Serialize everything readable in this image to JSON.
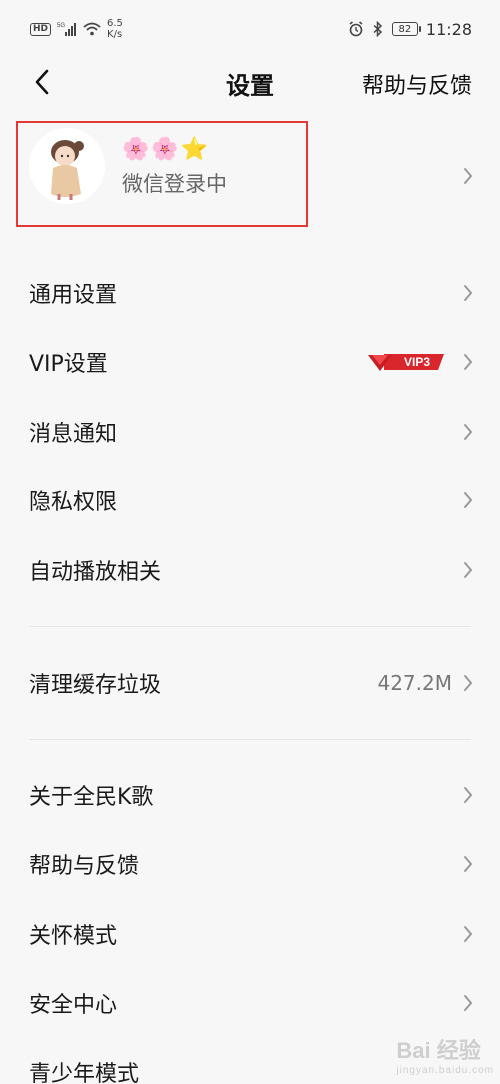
{
  "status_bar": {
    "network_badge": "HD",
    "signal_label": "5G",
    "speed_value": "6.5",
    "speed_unit": "K/s",
    "battery": "82",
    "time": "11:28"
  },
  "nav": {
    "title": "设置",
    "help_label": "帮助与反馈"
  },
  "profile": {
    "nickname_flowers": "🌸🌸",
    "nickname_star": "⭐",
    "login_status": "微信登录中"
  },
  "settings_group_1": [
    {
      "label": "通用设置"
    },
    {
      "label": "VIP设置",
      "badge": "VIP3"
    },
    {
      "label": "消息通知"
    },
    {
      "label": "隐私权限"
    },
    {
      "label": "自动播放相关"
    }
  ],
  "settings_group_2": [
    {
      "label": "清理缓存垃圾",
      "value": "427.2M"
    }
  ],
  "settings_group_3": [
    {
      "label": "关于全民K歌"
    },
    {
      "label": "帮助与反馈"
    },
    {
      "label": "关怀模式"
    },
    {
      "label": "安全中心"
    },
    {
      "label": "青少年模式"
    }
  ],
  "watermark": {
    "brand": "Bai 经验",
    "sub": "jingyan.baidu.com"
  },
  "colors": {
    "highlight_border": "#e53935",
    "vip_red": "#d9262c",
    "background": "#f7f7f7"
  },
  "icons": [
    "hd-icon",
    "signal-icon",
    "wifi-icon",
    "alarm-icon",
    "bluetooth-icon",
    "battery-icon",
    "back-arrow-icon",
    "chevron-right-icon",
    "vip-diamond-icon"
  ]
}
